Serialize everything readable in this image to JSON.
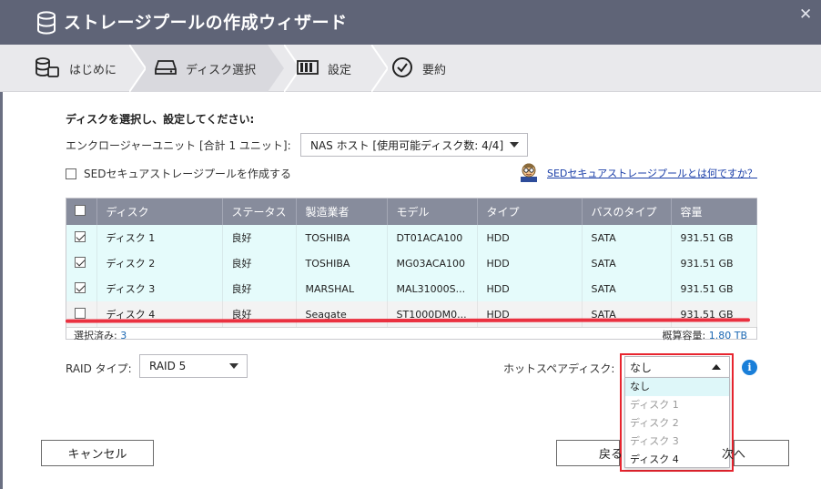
{
  "window": {
    "title": "ストレージプールの作成ウィザード",
    "close_glyph": "✕"
  },
  "steps": [
    {
      "label": "はじめに",
      "icon": "database-icon"
    },
    {
      "label": "ディスク選択",
      "icon": "hard-drive-icon"
    },
    {
      "label": "設定",
      "icon": "raid-array-icon"
    },
    {
      "label": "要約",
      "icon": "check-circle-icon"
    }
  ],
  "intro": "ディスクを選択し、設定してください:",
  "enclosure": {
    "label": "エンクロージャーユニット [合計 1 ユニット]:",
    "value": "NAS ホスト [使用可能ディスク数: 4/4]"
  },
  "sed": {
    "checkbox_label": "SEDセキュアストレージプールを作成する",
    "link": "SEDセキュアストレージプールとは何ですか？"
  },
  "table": {
    "headers": [
      "ディスク",
      "ステータス",
      "製造業者",
      "モデル",
      "タイプ",
      "バスのタイプ",
      "容量"
    ],
    "rows": [
      {
        "checked": true,
        "cells": [
          "ディスク 1",
          "良好",
          "TOSHIBA",
          "DT01ACA100",
          "HDD",
          "SATA",
          "931.51 GB"
        ]
      },
      {
        "checked": true,
        "cells": [
          "ディスク 2",
          "良好",
          "TOSHIBA",
          "MG03ACA100",
          "HDD",
          "SATA",
          "931.51 GB"
        ]
      },
      {
        "checked": true,
        "cells": [
          "ディスク 3",
          "良好",
          "MARSHAL",
          "MAL31000S...",
          "HDD",
          "SATA",
          "931.51 GB"
        ]
      },
      {
        "checked": false,
        "cells": [
          "ディスク 4",
          "良好",
          "Seagate",
          "ST1000DM0...",
          "HDD",
          "SATA",
          "931.51 GB"
        ]
      }
    ],
    "selected_label": "選択済み: ",
    "selected_count": "3",
    "capacity_label": "概算容量: ",
    "capacity_value": "1.80 TB"
  },
  "raid": {
    "label": "RAID タイプ:",
    "value": "RAID 5"
  },
  "hot_spare": {
    "label": "ホットスペアディスク:",
    "value": "なし",
    "options": [
      {
        "label": "なし",
        "state": "current"
      },
      {
        "label": "ディスク 1",
        "state": "disabled"
      },
      {
        "label": "ディスク 2",
        "state": "disabled"
      },
      {
        "label": "ディスク 3",
        "state": "disabled"
      },
      {
        "label": "ディスク 4",
        "state": "enabled"
      }
    ]
  },
  "buttons": {
    "cancel": "キャンセル",
    "back": "戻る",
    "next": "次へ"
  },
  "info_glyph": "i",
  "colors": {
    "title_bar": "#5f6477",
    "table_header": "#878c9c",
    "selected_row": "#e5fbfb",
    "highlight_red": "#e8252f",
    "link": "#1a3ea8",
    "info": "#1a7fd9"
  }
}
